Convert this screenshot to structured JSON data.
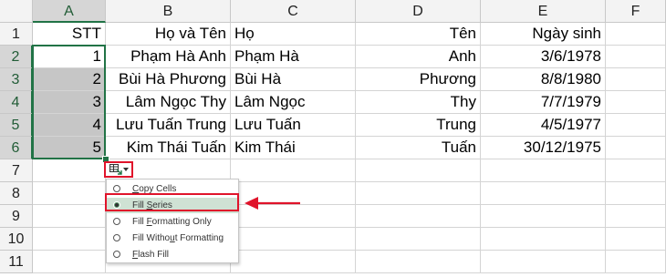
{
  "columns": [
    "A",
    "B",
    "C",
    "D",
    "E",
    "F"
  ],
  "rows": [
    "1",
    "2",
    "3",
    "4",
    "5",
    "6",
    "7",
    "8",
    "9",
    "10",
    "11"
  ],
  "cells": {
    "A": [
      "STT",
      "1",
      "2",
      "3",
      "4",
      "5"
    ],
    "B": [
      "Họ và Tên",
      "Phạm Hà Anh",
      "Bùi Hà Phương",
      "Lâm Ngọc Thy",
      "Lưu Tuấn Trung",
      "Kim Thái Tuấn"
    ],
    "C": [
      "Họ",
      "Phạm Hà",
      "Bùi Hà",
      "Lâm Ngọc",
      "Lưu Tuấn",
      "Kim Thái"
    ],
    "D": [
      "Tên",
      "Anh",
      "Phương",
      "Thy",
      "Trung",
      "Tuấn"
    ],
    "E": [
      "Ngày sinh",
      "3/6/1978",
      "8/8/1980",
      "7/7/1979",
      "4/5/1977",
      "30/12/1975"
    ]
  },
  "autofill_menu": {
    "options": [
      {
        "pre": "",
        "ul": "C",
        "post": "opy Cells",
        "selected": false
      },
      {
        "pre": "Fill ",
        "ul": "S",
        "post": "eries",
        "selected": true
      },
      {
        "pre": "Fill ",
        "ul": "F",
        "post": "ormatting Only",
        "selected": false
      },
      {
        "pre": "Fill Witho",
        "ul": "u",
        "post": "t Formatting",
        "selected": false
      },
      {
        "pre": "",
        "ul": "F",
        "post": "lash Fill",
        "selected": false
      }
    ]
  },
  "icons": {
    "autofill_options": "autofill-options-icon",
    "pointer": "red-arrow-icon"
  },
  "colors": {
    "selection_border": "#217346",
    "highlight": "#e0142b",
    "selected_option_bg": "#cfe2d4"
  }
}
